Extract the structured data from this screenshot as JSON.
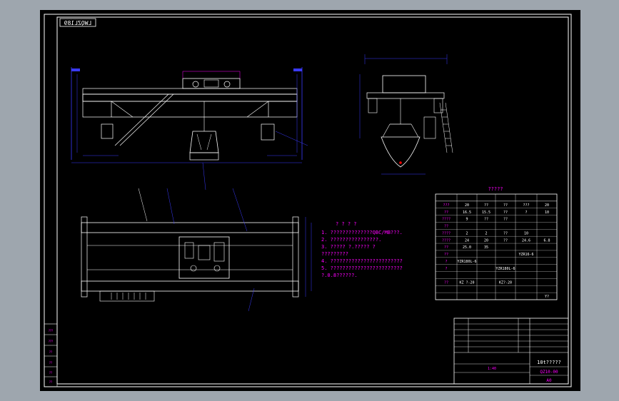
{
  "drawing": {
    "stamp": "LWQZL189",
    "background": "#000000",
    "frame_color": "#ffffff",
    "dimension_color": "#3a3aff",
    "text_color": "#ff00ff",
    "hatch_color": "#3a3aff",
    "accent_color": "#ff0000"
  },
  "notes": {
    "title": "? ? ? ?",
    "lines": [
      "1. ??????????????QBC/MB???.",
      "2. ????????????????.",
      "3. ????? ?.????? ?",
      "   ?????????",
      "4. ????????????????????????",
      "5. ????????????????????????",
      "   ?.0.8??????."
    ]
  },
  "tech_table": {
    "title": "?????",
    "header": [
      "??",
      "",
      "",
      "",
      "",
      ""
    ],
    "rows": [
      [
        "???",
        "20",
        "??",
        "??",
        "???",
        "20"
      ],
      [
        "??",
        "16.5",
        "15.5",
        "??",
        "?",
        "10"
      ],
      [
        "????",
        "9",
        "??",
        "??",
        "",
        ""
      ],
      [
        "??",
        "",
        "",
        "",
        "",
        ""
      ],
      [
        "????",
        "2",
        "2",
        "??",
        "10",
        ""
      ],
      [
        "????",
        "24",
        "20",
        "??",
        "24.6",
        "6.8"
      ],
      [
        "??",
        "25.0",
        "35",
        "",
        "",
        ""
      ],
      [
        "??",
        "",
        "",
        "",
        "YZR16-6",
        ""
      ],
      [
        "?",
        "YZR180L-6",
        "",
        "",
        "",
        ""
      ],
      [
        "?",
        "",
        "",
        "YZR180L-6",
        "",
        ""
      ],
      [
        "",
        "",
        "",
        "",
        "",
        ""
      ],
      [
        "??",
        "KZ ?-20",
        "",
        "KZ?-20",
        "",
        ""
      ],
      [
        "",
        "",
        "",
        "",
        "",
        ""
      ],
      [
        "",
        "",
        "",
        "",
        "",
        "Y?"
      ]
    ]
  },
  "title_block": {
    "drawing_name": "10t?????",
    "drawing_no": "QZ10-00",
    "sheet": "A0",
    "scale": "1:40"
  },
  "left_stamp_rows": [
    "???",
    "???",
    "??",
    "??",
    "??",
    "??"
  ]
}
